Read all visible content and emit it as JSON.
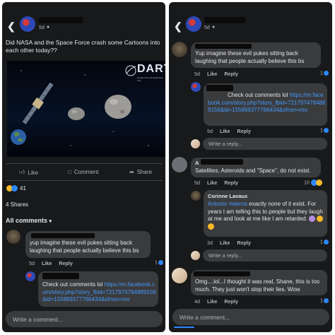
{
  "left": {
    "header": {
      "time": "5d"
    },
    "post": {
      "text": "Did NASA and the Space Force crash some Cartoons into each other today??",
      "banner_logo": "DART",
      "banner_sub": "Double Asteroid Redirection Test"
    },
    "actions": {
      "like": "Like",
      "comment": "Comment",
      "share": "Share"
    },
    "reactions_count": "41",
    "shares": "4 Shares",
    "all_comments": "All comments",
    "comments": [
      {
        "text": "yup imagine these evil pukes sitting back laughing that people actually believe this bs",
        "time": "5d",
        "like": "Like",
        "reply": "Reply",
        "count": "1"
      },
      {
        "text_prefix": "Check out comments lol ",
        "link": "https://m.facebook.com/story.php?story_fbid=7217974784889156&id=155869377766434&sfnsn=mo",
        "time": "5d",
        "like": "Like",
        "reply": "Reply"
      }
    ],
    "write_placeholder": "Write a comment..."
  },
  "right": {
    "header": {
      "time": "5d"
    },
    "comments": [
      {
        "text": "Yup imagine these evil pukes sitting back laughing that people actually believe this bs",
        "time": "5d",
        "like": "Like",
        "reply": "Reply",
        "count": "1"
      },
      {
        "text_prefix": "Check out comments lol ",
        "link": "https://m.facebook.com/story.php?story_fbid=7217974784889156&id=155869377766434&sfnsn=mo",
        "time": "5d",
        "like": "Like",
        "reply": "Reply",
        "count": "1"
      },
      {
        "name_initial": "A",
        "text": "Satellites, Asteroids and \"Space\", do not exist.",
        "time": "5d",
        "like": "Like",
        "reply": "Reply",
        "count": "10"
      },
      {
        "name": "Corinne Lavaux",
        "mention": "Antonio Valeros",
        "text": " exactly none of it exist. For years I am telling this to people but they laugh at me and look at me like I am retarded.",
        "time": "3d",
        "like": "Like",
        "reply": "Reply",
        "count": "1"
      },
      {
        "text": "Omg....lol...I thought it was real, Shane, this is too much. They just won't stop their lies. Wow",
        "time": "4d",
        "like": "Like",
        "reply": "Reply",
        "count": "1"
      }
    ],
    "reply_placeholder": "Write a reply...",
    "write_placeholder": "Write a comment..."
  },
  "colors": {
    "background": "#18191a",
    "bubble": "#3a3b3c",
    "link": "#4599ff",
    "accent": "#2d88ff"
  }
}
